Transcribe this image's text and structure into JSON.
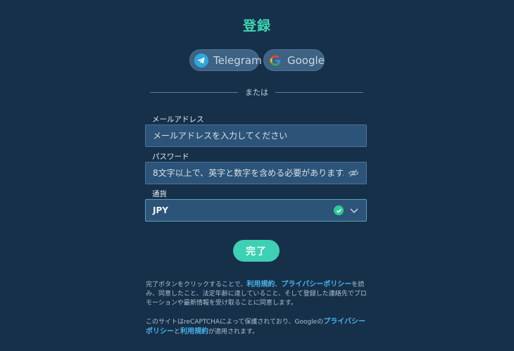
{
  "page": {
    "title": "登録"
  },
  "social": {
    "telegram_label": "Telegram",
    "google_label": "Google"
  },
  "divider": {
    "text": "または"
  },
  "form": {
    "email_label": "メールアドレス",
    "email_placeholder": "メールアドレスを入力してください",
    "password_label": "パスワード",
    "password_placeholder": "8文字以上で、英字と数字を含める必要があります。",
    "currency_label": "通貨",
    "currency_value": "JPY",
    "submit_label": "完了"
  },
  "legal": {
    "terms_prefix": "完了ボタンをクリックすることで、",
    "terms_link": "利用規約",
    "terms_sep": "、",
    "privacy_link": "プライバシーポリシー",
    "terms_suffix": "を読み、同意したこと、法定年齢に達していること、そして登録した連絡先でプロモーションや最新情報を受け取ることに同意します。",
    "recaptcha_prefix": "このサイトはreCAPTCHAによって保護されており、Googleの",
    "recaptcha_privacy_link": "プライバシーポリシー",
    "recaptcha_and": "と",
    "recaptcha_terms_link": "利用規約",
    "recaptcha_suffix": "が適用されます。"
  },
  "colors": {
    "background": "#17304a",
    "accent": "#3ed0b4",
    "link": "#4ab4ec",
    "field": "#2c5478"
  },
  "icons": [
    "telegram-icon",
    "google-icon",
    "eye-off-icon",
    "check-circle-icon",
    "chevron-down-icon"
  ]
}
